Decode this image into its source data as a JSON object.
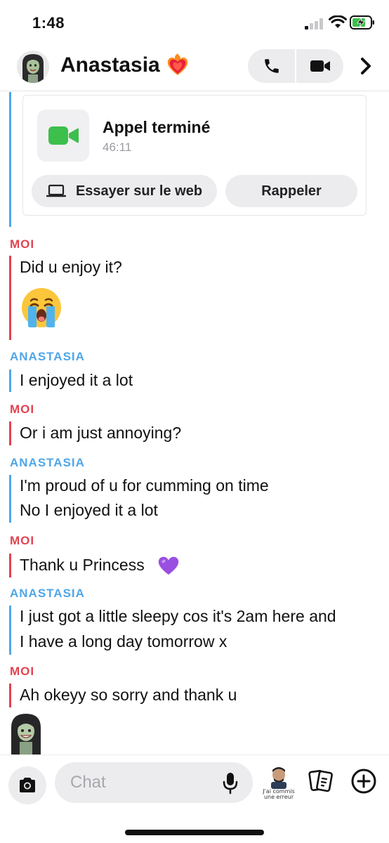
{
  "status_bar": {
    "time": "1:48"
  },
  "header": {
    "contact_name": "Anastasia"
  },
  "call_card": {
    "title": "Appel terminé",
    "duration": "46:11",
    "try_web_label": "Essayer sur le web",
    "recall_label": "Rappeler"
  },
  "messages": {
    "me_label": "MOI",
    "them_label": "ANASTASIA",
    "m1": "Did u enjoy it?",
    "m2": "I enjoyed it a lot",
    "m3": "Or i am just annoying?",
    "m4": "I'm proud of u for cumming on time",
    "m5": "No I enjoyed it a lot",
    "m6": "Thank u Princess",
    "m7a": "I just got a little sleepy cos it's 2am here and",
    "m7b": "I have a long day tomorrow x",
    "m8": "Ah okeyy so sorry and thank u"
  },
  "composer": {
    "placeholder": "Chat",
    "bitmoji_caption_line1": "J'ai commis",
    "bitmoji_caption_line2": "une erreur"
  },
  "icons": {
    "status": [
      "signal-icon",
      "wifi-icon",
      "battery-charging-icon"
    ],
    "header": [
      "avatar",
      "heart-fire-emoji",
      "phone-icon",
      "video-camera-icon",
      "chevron-right-icon"
    ],
    "call_card": [
      "video-call-icon",
      "laptop-icon"
    ],
    "messages": [
      "crying-face-emoji",
      "purple-heart-emoji"
    ],
    "composer": [
      "camera-icon",
      "microphone-icon",
      "bitmoji-icon",
      "cards-icon",
      "plus-circle-icon"
    ]
  },
  "colors": {
    "me_accent": "#e2424f",
    "them_accent": "#4fa6e8",
    "video_green": "#3dbf4c",
    "pill_bg": "#ececee"
  }
}
